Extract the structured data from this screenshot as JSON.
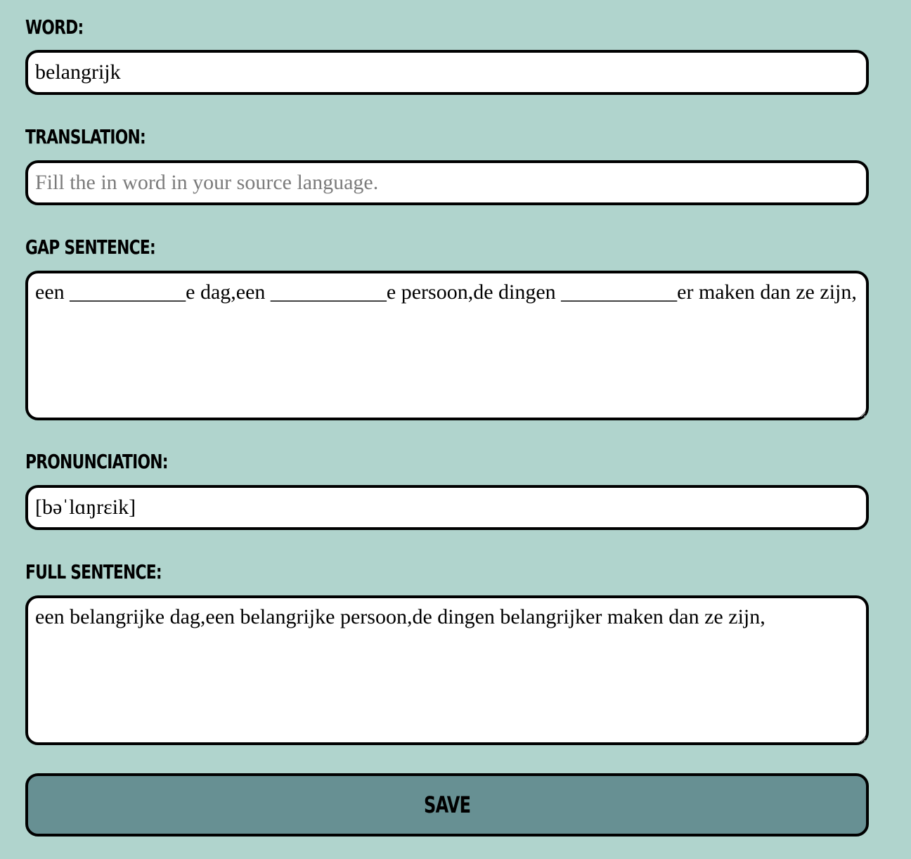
{
  "form": {
    "word": {
      "label": "Word:",
      "value": "belangrijk",
      "placeholder": ""
    },
    "translation": {
      "label": "Translation:",
      "value": "",
      "placeholder": "Fill the in word in your source language."
    },
    "gap_sentence": {
      "label": "Gap Sentence:",
      "value": "een ___________e dag,een ___________e persoon,de dingen ___________er maken dan ze zijn,"
    },
    "pronunciation": {
      "label": "Pronunciation:",
      "value": "[bəˈlɑŋrɛik]"
    },
    "full_sentence": {
      "label": "Full Sentence:",
      "value": "een belangrijke dag,een belangrijke persoon,de dingen belangrijker maken dan ze zijn,"
    },
    "save_label": "Save"
  },
  "colors": {
    "background": "#b0d4cd",
    "field_background": "#ffffff",
    "border": "#000000",
    "button_background": "#679093",
    "placeholder_text": "#7b7b7b"
  }
}
